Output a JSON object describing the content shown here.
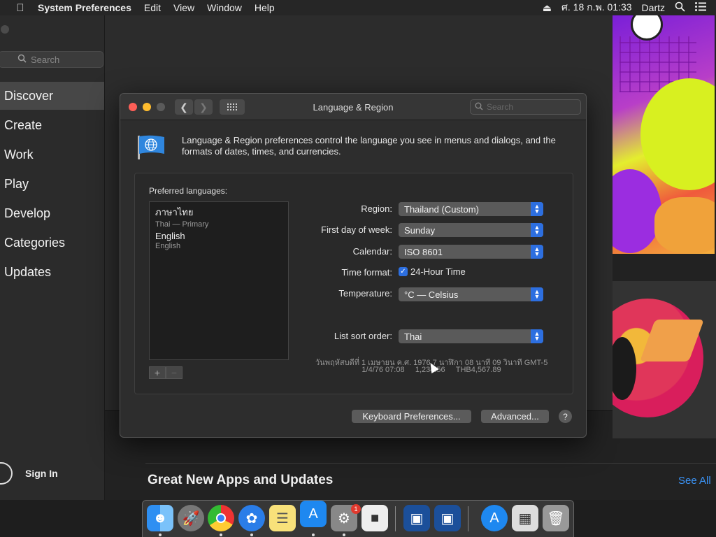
{
  "menubar": {
    "apple_icon": "apple-icon",
    "app_name": "System Preferences",
    "menus": [
      "Edit",
      "View",
      "Window",
      "Help"
    ],
    "clock": "ศ. 18 ก.พ. 01:33",
    "user": "Dartz"
  },
  "store": {
    "search_placeholder": "Search",
    "nav": [
      "Discover",
      "Create",
      "Work",
      "Play",
      "Develop",
      "Categories",
      "Updates"
    ],
    "active_nav": "Discover",
    "sign_in": "Sign In",
    "section_title": "Great New Apps and Updates",
    "see_all": "See All"
  },
  "window": {
    "title": "Language & Region",
    "search_placeholder": "Search",
    "description": "Language & Region preferences control the language you see in menus and dialogs, and the formats of dates, times, and currencies.",
    "preferred_label": "Preferred languages:",
    "languages": [
      {
        "name": "ภาษาไทย",
        "sub": "Thai — Primary"
      },
      {
        "name": "English",
        "sub": "English"
      }
    ],
    "add_label": "+",
    "remove_label": "−",
    "region_label": "Region:",
    "region_value": "Thailand (Custom)",
    "week_label": "First day of week:",
    "week_value": "Sunday",
    "calendar_label": "Calendar:",
    "calendar_value": "ISO 8601",
    "time_label": "Time format:",
    "time_value": "24-Hour Time",
    "time_checked": true,
    "temp_label": "Temperature:",
    "temp_value": "°C — Celsius",
    "sort_label": "List sort order:",
    "sort_value": "Thai",
    "sample_line1": "วันพฤหัสบดีที่ 1 เมษายน ค.ศ. 1976 7 นาฬิกา 08 นาที 09 วินาที GMT-5",
    "sample_line2": "1/4/76 07:08     1,234.56     THB4,567.89",
    "keyboard_button": "Keyboard Preferences...",
    "advanced_button": "Advanced...",
    "help_button": "?"
  },
  "dock": {
    "items": [
      "finder-icon",
      "launchpad-icon",
      "chrome-icon",
      "safari-icon",
      "notes-icon",
      "app-store-icon",
      "system-preferences-icon",
      "roblox-icon",
      "virtualbox-icon",
      "virtualbox-vm-icon",
      "app-store-download-icon",
      "preview-icon",
      "trash-icon"
    ],
    "badge": "1"
  },
  "colors": {
    "accent": "#2d6fe0",
    "link": "#3b94f7",
    "close": "#fe5f57",
    "minimize": "#febc2e",
    "zoom": "#5a5a5a"
  }
}
